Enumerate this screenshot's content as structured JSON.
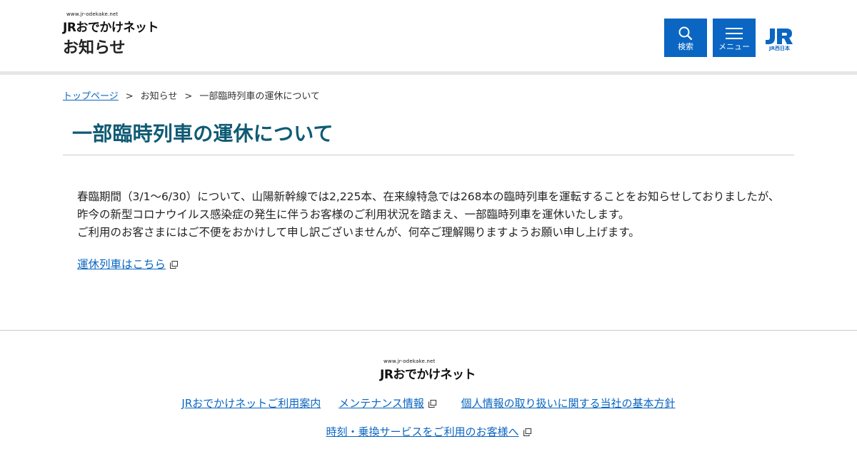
{
  "header": {
    "logo_url_text": "www.jr-odekake.net",
    "logo_text": "JRおでかけネット",
    "page_label": "お知らせ",
    "search_label": "検索",
    "menu_label": "メニュー",
    "brand_mark_text": "JR西日本",
    "brand_color": "#0a66c2"
  },
  "breadcrumb": {
    "home": "トップページ",
    "separator": ">",
    "section": "お知らせ",
    "current": "一部臨時列車の運休について"
  },
  "article": {
    "title": "一部臨時列車の運休について",
    "title_color": "#0f5a73",
    "paragraph1": "春臨期間（3/1～6/30）について、山陽新幹線では2,225本、在来線特急では268本の臨時列車を運転することをお知らせしておりましたが、昨今の新型コロナウイルス感染症の発生に伴うお客様のご利用状況を踏まえ、一部臨時列車を運休いたします。",
    "paragraph2": "ご利用のお客さまにはご不便をおかけして申し訳ございませんが、何卒ご理解賜りますようお願い申し上げます。",
    "link_label": "運休列車はこちら"
  },
  "footer": {
    "logo_url_text": "www.jr-odekake.net",
    "logo_text": "JRおでかけネット",
    "links": [
      "JRおでかけネットご利用案内",
      "メンテナンス情報",
      "個人情報の取り扱いに関する当社の基本方針"
    ],
    "link_row2": "時刻・乗換サービスをご利用のお客様へ"
  }
}
